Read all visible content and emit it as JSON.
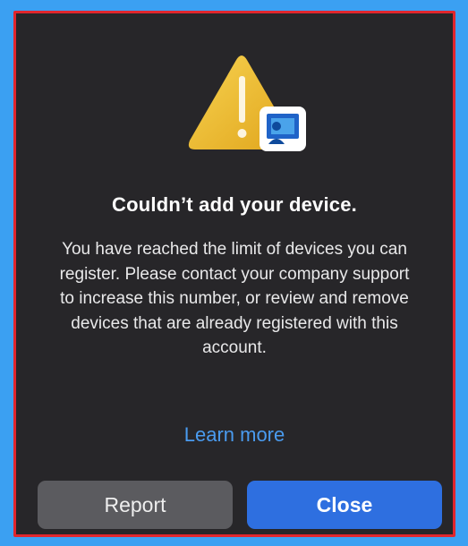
{
  "dialog": {
    "title": "Couldn’t add your device.",
    "message": "You have reached the limit of devices you can register. Please contact your company support to increase this number, or review and remove devices that are already registered with this account.",
    "learn_more_label": "Learn more",
    "report_label": "Report",
    "close_label": "Close",
    "icon": "warning-device-icon"
  },
  "colors": {
    "dialog_background": "#272629",
    "frame_border": "#e0262d",
    "outer_background": "#3ba0f2",
    "link": "#4a9bef",
    "primary_button": "#2e6fe0",
    "secondary_button": "#5b5b5f",
    "warning_yellow": "#f2c230"
  }
}
